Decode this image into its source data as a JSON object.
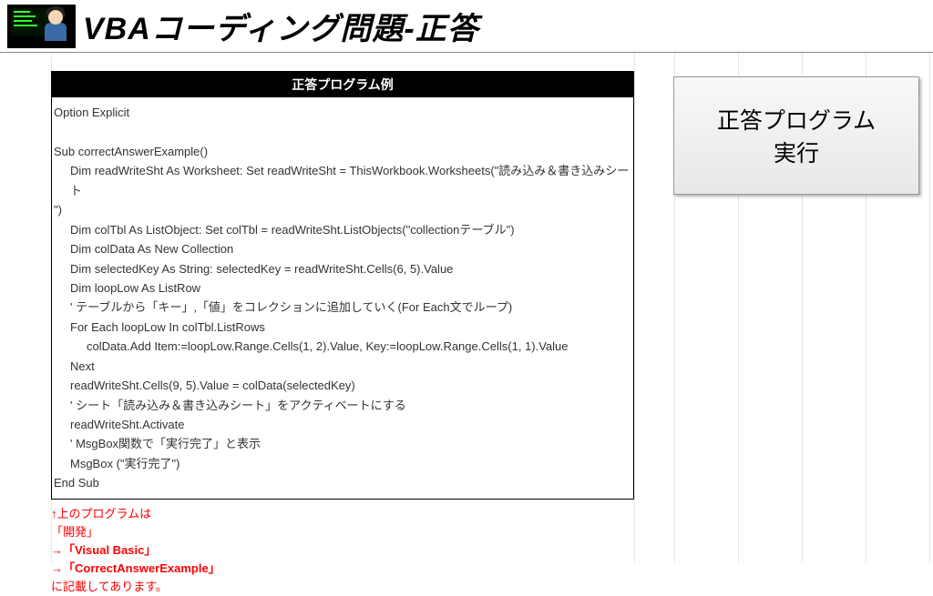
{
  "header": {
    "title": "VBAコーディング問題-正答"
  },
  "codeBlock": {
    "headerLabel": "正答プログラム例",
    "lines": [
      {
        "text": "Option Explicit",
        "indent": 0
      },
      {
        "text": " ",
        "indent": 0
      },
      {
        "text": "Sub correctAnswerExample()",
        "indent": 0
      },
      {
        "text": "Dim readWriteSht As Worksheet: Set readWriteSht = ThisWorkbook.Worksheets(\"読み込み＆書き込みシート",
        "indent": 1
      },
      {
        "text": "\")",
        "indent": 0
      },
      {
        "text": "Dim colTbl As ListObject: Set colTbl = readWriteSht.ListObjects(\"collectionテーブル\")",
        "indent": 1
      },
      {
        "text": "Dim colData As New Collection",
        "indent": 1
      },
      {
        "text": "Dim selectedKey As String: selectedKey = readWriteSht.Cells(6, 5).Value",
        "indent": 1
      },
      {
        "text": "Dim loopLow As ListRow",
        "indent": 1
      },
      {
        "text": "' テーブルから「キー」,「値」をコレクションに追加していく(For Each文でループ)",
        "indent": 1
      },
      {
        "text": "For Each loopLow In colTbl.ListRows",
        "indent": 1
      },
      {
        "text": "colData.Add Item:=loopLow.Range.Cells(1, 2).Value, Key:=loopLow.Range.Cells(1, 1).Value",
        "indent": 2
      },
      {
        "text": "Next",
        "indent": 1
      },
      {
        "text": "readWriteSht.Cells(9, 5).Value = colData(selectedKey)",
        "indent": 1
      },
      {
        "text": "' シート「読み込み＆書き込みシート」をアクティベートにする",
        "indent": 1
      },
      {
        "text": "readWriteSht.Activate",
        "indent": 1
      },
      {
        "text": "' MsgBox関数で「実行完了」と表示",
        "indent": 1
      },
      {
        "text": "MsgBox (\"実行完了\")",
        "indent": 1
      },
      {
        "text": "End Sub",
        "indent": 0
      }
    ]
  },
  "notes": {
    "lines": [
      {
        "text": "↑上のプログラムは",
        "bold": false
      },
      {
        "text": "「開発」",
        "bold": false
      },
      {
        "text": "→「Visual Basic」",
        "bold": true
      },
      {
        "text": "→「CorrectAnswerExample」",
        "bold": true
      },
      {
        "text": "に記載してあります。",
        "bold": false
      }
    ]
  },
  "runButton": {
    "line1": "正答プログラム",
    "line2": "実行"
  }
}
